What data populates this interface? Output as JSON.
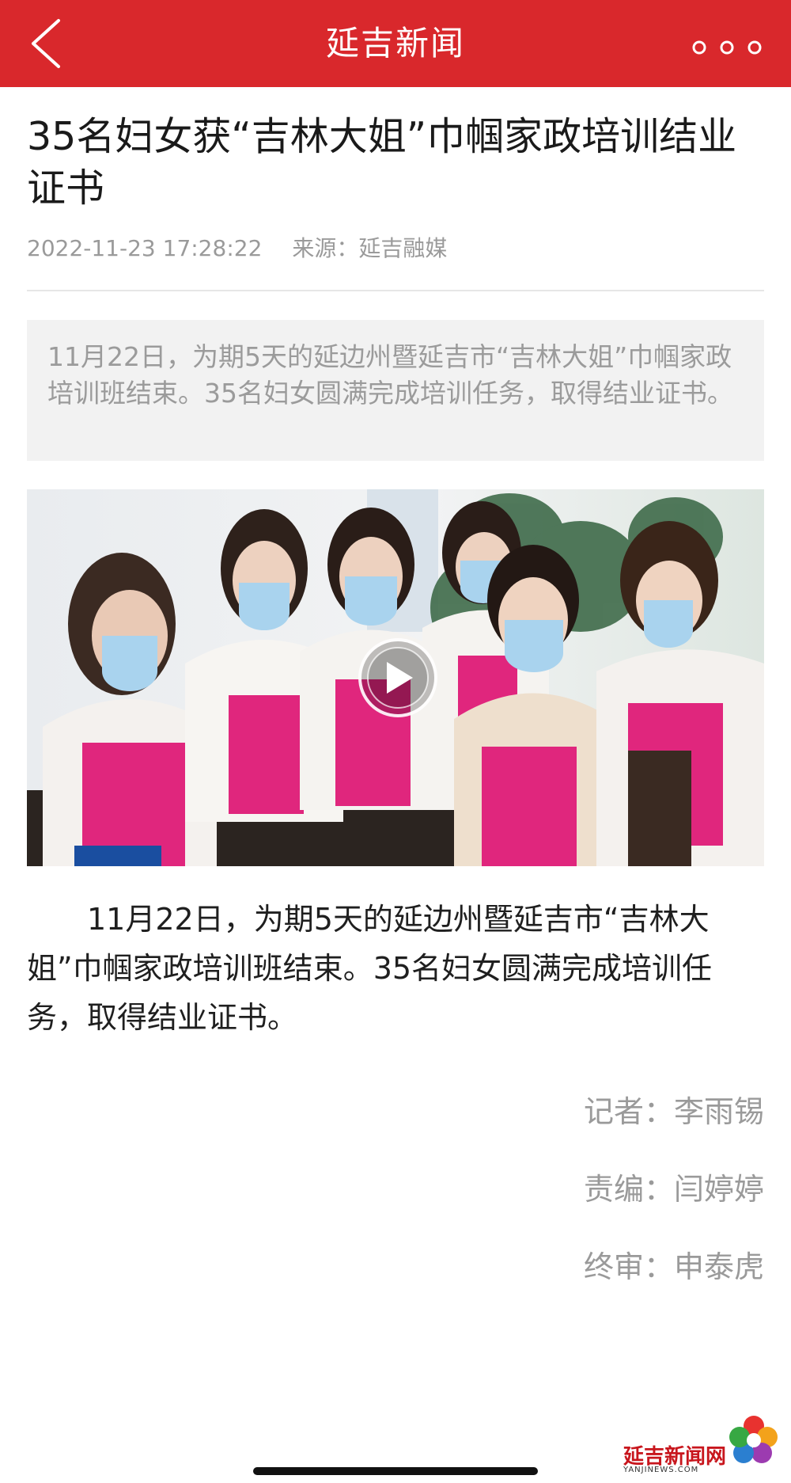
{
  "header": {
    "title": "延吉新闻",
    "back_icon": "chevron-left-icon",
    "more_icon": "more-dots-icon",
    "color": "#d9282c"
  },
  "article": {
    "title": "35名妇女获“吉林大姐”巾帼家政培训结业证书",
    "date": "2022-11-23 17:28:22",
    "source": "来源：延吉融媒",
    "summary": "11月22日，为期5天的延边州暨延吉市“吉林大姐”巾帼家政培训班结束。35名妇女圆满完成培训任务，取得结业证书。",
    "video": {
      "play_icon": "play-icon"
    },
    "body": "11月22日，为期5天的延边州暨延吉市“吉林大姐”巾帼家政培训班结束。35名妇女圆满完成培训任务，取得结业证书。",
    "credits": {
      "reporter": "记者：李雨锡",
      "editor": "责编：闫婷婷",
      "reviewer": "终审：申泰虎"
    }
  },
  "watermark": {
    "text": "延吉新闻网",
    "url_text": "YANJINEWS.COM"
  }
}
